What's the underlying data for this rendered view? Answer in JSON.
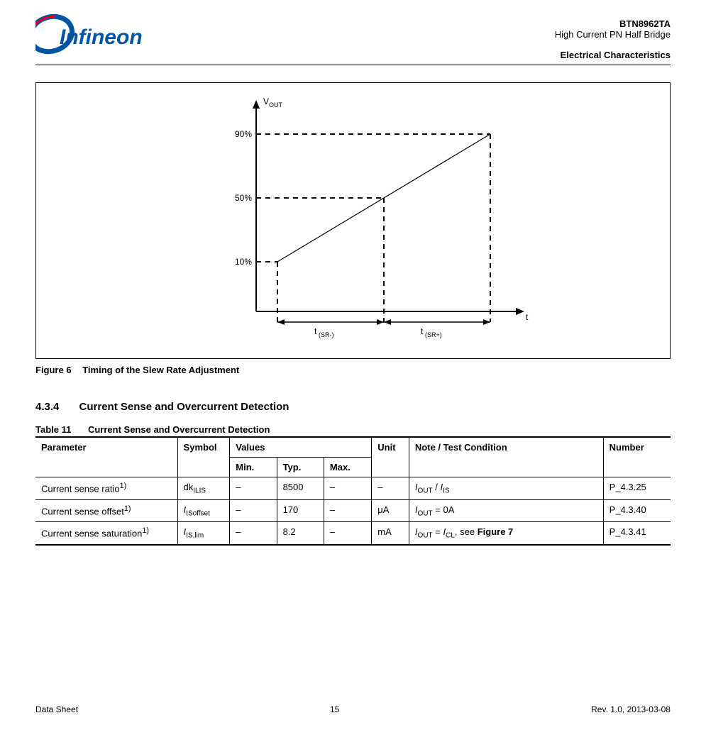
{
  "header": {
    "product": "BTN8962TA",
    "subtitle": "High Current PN Half Bridge",
    "section_path": "Electrical Characteristics"
  },
  "figure": {
    "label": "Figure 6",
    "title": "Timing of the Slew Rate Adjustment"
  },
  "chart_data": {
    "type": "line",
    "y_label": "V_OUT",
    "x_label": "t",
    "y_ticks": [
      "10%",
      "50%",
      "90%"
    ],
    "x_ranges": [
      "t_(SR-)",
      "t_(SR+)"
    ],
    "series": [
      {
        "name": "Vout",
        "points": [
          [
            0.08,
            0.1
          ],
          [
            1.0,
            0.9
          ]
        ]
      }
    ],
    "xlim": [
      0,
      1.05
    ],
    "ylim": [
      0,
      1.0
    ]
  },
  "section": {
    "number": "4.3.4",
    "title": "Current Sense and Overcurrent Detection"
  },
  "table": {
    "label": "Table 11",
    "title": "Current Sense and Overcurrent Detection",
    "columns": {
      "param": "Parameter",
      "symbol": "Symbol",
      "values": "Values",
      "min": "Min.",
      "typ": "Typ.",
      "max": "Max.",
      "unit": "Unit",
      "note": "Note / Test Condition",
      "num": "Number"
    },
    "rows": [
      {
        "param": "Current sense ratio",
        "param_sup": "1)",
        "symbol_html": "dk<sub>ILIS</sub>",
        "values_cells": [
          "–",
          "8500",
          "–"
        ],
        "unit": "–",
        "note_html": "<i>I</i><sub>OUT</sub> / <i>I</i><sub>IS</sub>",
        "num": "P_4.3.25"
      },
      {
        "param": "Current sense offset",
        "param_sup": "1)",
        "symbol_html": "<i>I</i><sub>ISoffset</sub>",
        "values_cells": [
          "–",
          "170",
          "–"
        ],
        "unit": "μA",
        "note_html": "<i>I</i><sub>OUT</sub> = 0A",
        "num": "P_4.3.40"
      },
      {
        "param": "Current sense saturation",
        "param_sup": "1)",
        "symbol_html": "<i>I</i><sub>IS,lim</sub>",
        "values_cells": [
          "–",
          "8.2",
          "–"
        ],
        "unit": "mA",
        "note_html": "<i>I</i><sub>OUT</sub> = <i>I</i><sub>CL</sub>, see <b>Figure 7</b>",
        "num": "P_4.3.41"
      }
    ]
  },
  "footer": {
    "left": "Data Sheet",
    "center": "15",
    "right": "Rev. 1.0, 2013-03-08"
  }
}
